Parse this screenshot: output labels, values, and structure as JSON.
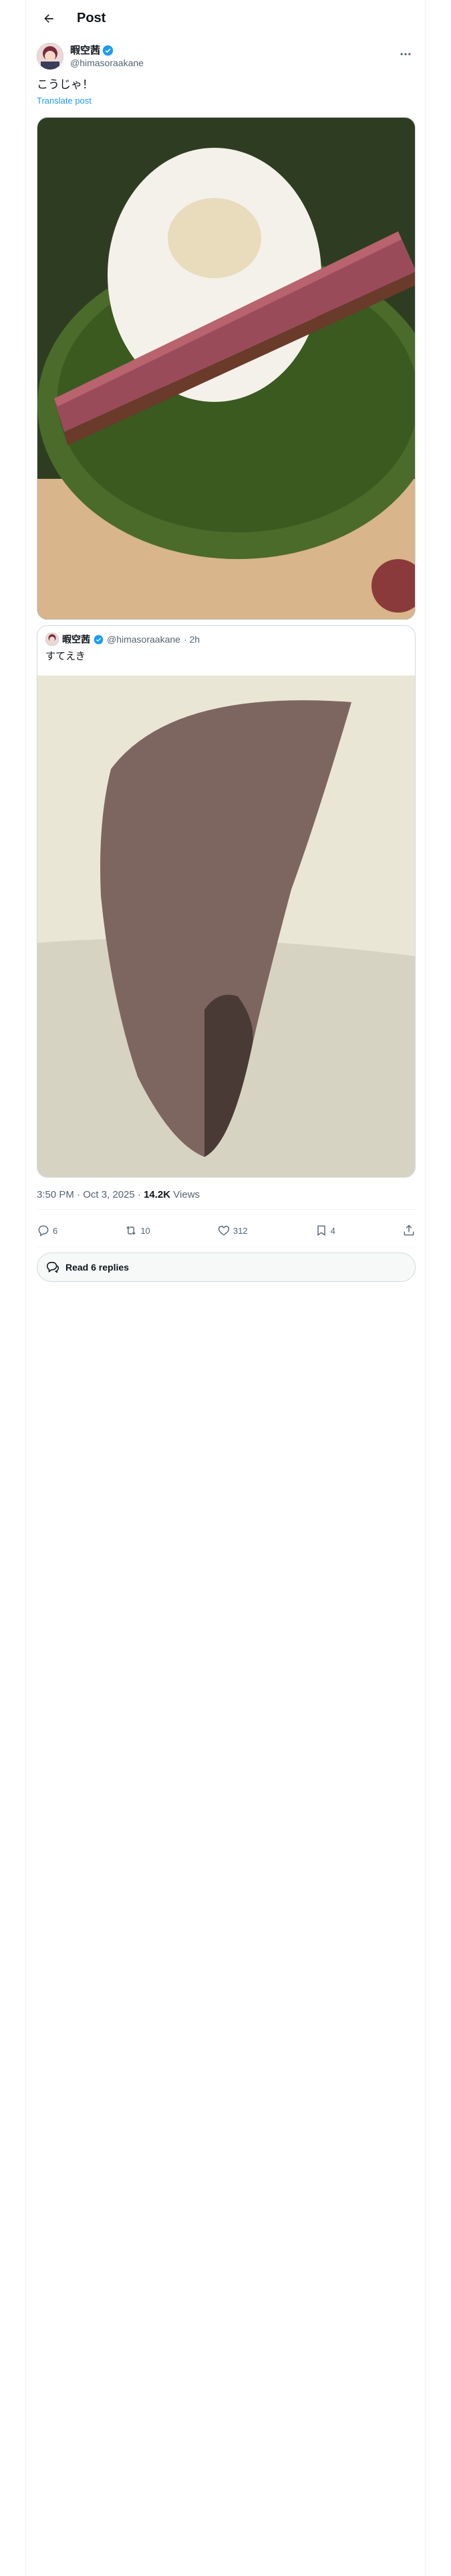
{
  "header": {
    "title": "Post"
  },
  "post": {
    "author": {
      "display_name": "暇空茜",
      "handle": "@himasoraakane"
    },
    "text": "こうじゃ！",
    "translate_label": "Translate post",
    "image_alt": "Steak slice on rice on a green plate"
  },
  "quote": {
    "author": {
      "display_name": "暇空茜",
      "handle": "@himasoraakane",
      "age": "· 2h"
    },
    "text": "すてえき",
    "image_alt": "Raw steak on a white surface"
  },
  "meta": {
    "time": "3:50 PM · Oct 3, 2025 ·",
    "views_count": "14.2K",
    "views_label": "Views"
  },
  "actions": {
    "replies": "6",
    "reposts": "10",
    "likes": "312",
    "bookmarks": "4"
  },
  "read_replies": {
    "label": "Read 6 replies"
  },
  "colors": {
    "accent": "#1d9bf0",
    "verified": "#1d9bf0",
    "secondary_text": "#536471"
  }
}
